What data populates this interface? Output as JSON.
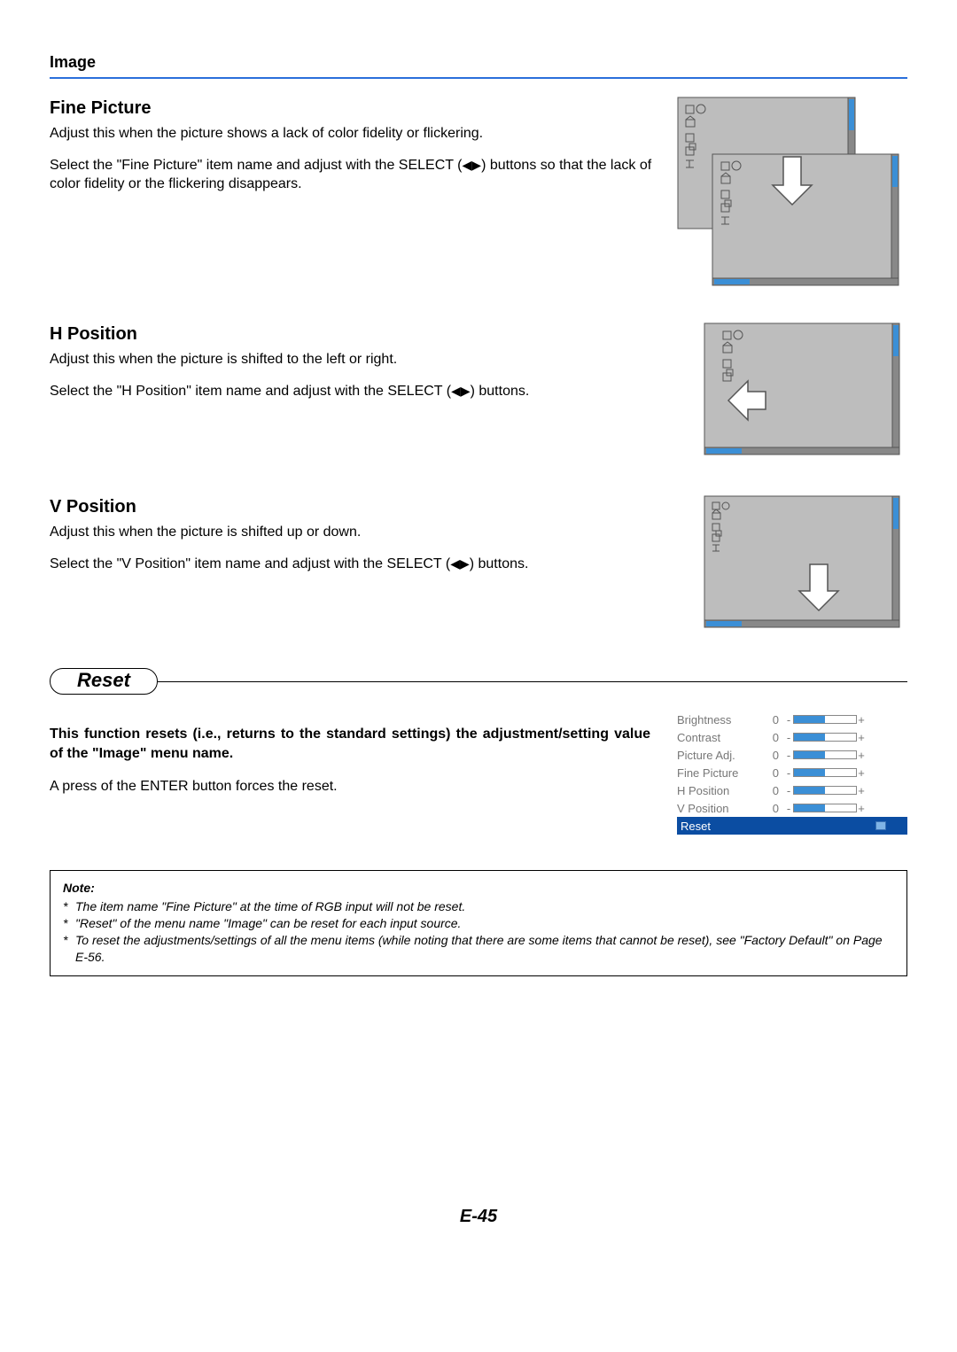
{
  "breadcrumb": "Image",
  "sections": {
    "fine_picture": {
      "title": "Fine Picture",
      "p1": "Adjust this when the picture shows a lack of color fidelity or flickering.",
      "p2a": "Select the \"Fine Picture\" item name and adjust with the SELECT (",
      "p2b": ") buttons so that the lack of color fidelity or the flickering disappears."
    },
    "h_position": {
      "title": "H Position",
      "p1": "Adjust this when the picture is shifted to the left or right.",
      "p2a": "Select the \"H Position\" item name and adjust with the SELECT (",
      "p2b": ") buttons."
    },
    "v_position": {
      "title": "V Position",
      "p1": "Adjust this when the picture is shifted up or down.",
      "p2a": "Select the \"V Position\" item name and adjust with the SELECT (",
      "p2b": ") buttons."
    }
  },
  "reset": {
    "heading": "Reset",
    "bold": "This function resets (i.e., returns to the standard settings) the adjustment/setting value of the \"Image\" menu name.",
    "p": "A press of the ENTER button forces the reset.",
    "menu": {
      "rows": [
        {
          "label": "Brightness",
          "value": "0"
        },
        {
          "label": "Contrast",
          "value": "0"
        },
        {
          "label": "Picture Adj.",
          "value": "0"
        },
        {
          "label": "Fine Picture",
          "value": "0"
        },
        {
          "label": "H Position",
          "value": "0"
        },
        {
          "label": "V Position",
          "value": "0"
        }
      ],
      "reset_label": "Reset"
    }
  },
  "note": {
    "title": "Note:",
    "items": [
      "The item name \"Fine Picture\" at the time of RGB input will not be reset.",
      "\"Reset\" of the menu name \"Image\" can be reset for each input source.",
      "To reset the adjustments/settings of all the menu items (while noting that there are some items that cannot be reset), see \"Factory Default\" on Page E-56."
    ]
  },
  "page_number": "E-45"
}
